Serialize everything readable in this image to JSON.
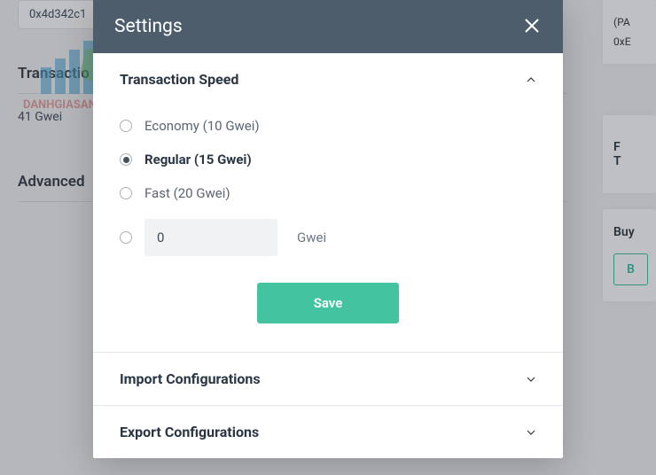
{
  "background": {
    "address": "0x4d342c1",
    "transaction_heading": "Transactio",
    "gwei_text": "41 Gwei",
    "advanced_heading": "Advanced",
    "right_pa": "(PA",
    "right_addr": "0xE",
    "right_f": "F",
    "right_t": "T",
    "right_buy": "Buy",
    "right_buy_btn": "B"
  },
  "modal": {
    "title": "Settings",
    "sections": {
      "speed": {
        "title": "Transaction Speed",
        "options": [
          {
            "label": "Economy (10 Gwei)",
            "selected": false
          },
          {
            "label": "Regular (15 Gwei)",
            "selected": true
          },
          {
            "label": "Fast (20 Gwei)",
            "selected": false
          }
        ],
        "custom_value": "0",
        "custom_suffix": "Gwei",
        "save_label": "Save"
      },
      "import": {
        "title": "Import Configurations"
      },
      "export": {
        "title": "Export Configurations"
      }
    }
  }
}
